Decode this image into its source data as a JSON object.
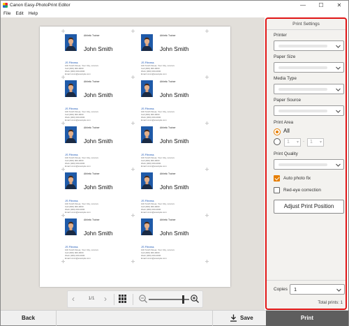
{
  "window": {
    "title": "Canon Easy-PhotoPrint Editor",
    "minimize": "—",
    "maximize": "☐",
    "close": "✕"
  },
  "menu": [
    "File",
    "Edit",
    "Help"
  ],
  "cards": [
    {
      "job": "Athletic Trainer",
      "name": "John Smith",
      "company": "JS Fitness",
      "address": [
        "100 Smith Street, Your City, xxxxxxx",
        "Cell (000) 000-0000",
        "Work (000) 000-0000",
        "Email xxxxx@example.com"
      ]
    },
    {
      "job": "Athletic Trainer",
      "name": "John Smith",
      "company": "JS Fitness",
      "address": [
        "100 Smith Street, Your City, xxxxxxx",
        "Cell (000) 000-0000",
        "Work (000) 000-0000",
        "Email xxxxx@example.com"
      ]
    },
    {
      "job": "Athletic Trainer",
      "name": "John Smith",
      "company": "JS Fitness",
      "address": [
        "100 Smith Street, Your City, xxxxxxx",
        "Cell (000) 000-0000",
        "Work (000) 000-0000",
        "Email xxxxx@example.com"
      ]
    },
    {
      "job": "Athletic Trainer",
      "name": "John Smith",
      "company": "JS Fitness",
      "address": [
        "100 Smith Street, Your City, xxxxxxx",
        "Cell (000) 000-0000",
        "Work (000) 000-0000",
        "Email xxxxx@example.com"
      ]
    },
    {
      "job": "Athletic Trainer",
      "name": "John Smith",
      "company": "JS Fitness",
      "address": [
        "100 Smith Street, Your City, xxxxxxx",
        "Cell (000) 000-0000",
        "Work (000) 000-0000",
        "Email xxxxx@example.com"
      ]
    },
    {
      "job": "Athletic Trainer",
      "name": "John Smith",
      "company": "JS Fitness",
      "address": [
        "100 Smith Street, Your City, xxxxxxx",
        "Cell (000) 000-0000",
        "Work (000) 000-0000",
        "Email xxxxx@example.com"
      ]
    },
    {
      "job": "Athletic Trainer",
      "name": "John Smith",
      "company": "JS Fitness",
      "address": [
        "100 Smith Street, Your City, xxxxxxx",
        "Cell (000) 000-0000",
        "Work (000) 000-0000",
        "Email xxxxx@example.com"
      ]
    },
    {
      "job": "Athletic Trainer",
      "name": "John Smith",
      "company": "JS Fitness",
      "address": [
        "100 Smith Street, Your City, xxxxxxx",
        "Cell (000) 000-0000",
        "Work (000) 000-0000",
        "Email xxxxx@example.com"
      ]
    },
    {
      "job": "Athletic Trainer",
      "name": "John Smith",
      "company": "JS Fitness",
      "address": [
        "100 Smith Street, Your City, xxxxxxx",
        "Cell (000) 000-0000",
        "Work (000) 000-0000",
        "Email xxxxx@example.com"
      ]
    },
    {
      "job": "Athletic Trainer",
      "name": "John Smith",
      "company": "JS Fitness",
      "address": [
        "100 Smith Street, Your City, xxxxxxx",
        "Cell (000) 000-0000",
        "Work (000) 000-0000",
        "Email xxxxx@example.com"
      ]
    }
  ],
  "pager": {
    "page": "1/1",
    "prev_icon": "chevron-left-icon",
    "next_icon": "chevron-right-icon",
    "thumbnails_icon": "grid-icon",
    "zoom_level": 0.85
  },
  "settings": {
    "title": "Print Settings",
    "printer_label": "Printer",
    "paper_size_label": "Paper Size",
    "media_type_label": "Media Type",
    "paper_source_label": "Paper Source",
    "print_area_label": "Print Area",
    "all_label": "All",
    "range_from": "1",
    "range_sep": "-",
    "range_to": "1",
    "print_quality_label": "Print Quality",
    "auto_fix_label": "Auto photo fix",
    "auto_fix_checked": true,
    "red_eye_label": "Red-eye correction",
    "red_eye_checked": false,
    "adjust_label": "Adjust Print Position",
    "copies_label": "Copies",
    "copies_value": "1",
    "total_prints": "Total prints: 1"
  },
  "footer": {
    "back_label": "Back",
    "save_label": "Save",
    "print_label": "Print"
  },
  "colors": {
    "accent": "#e67e00",
    "highlight": "#e01515",
    "print_button": "#5e5e5e"
  }
}
